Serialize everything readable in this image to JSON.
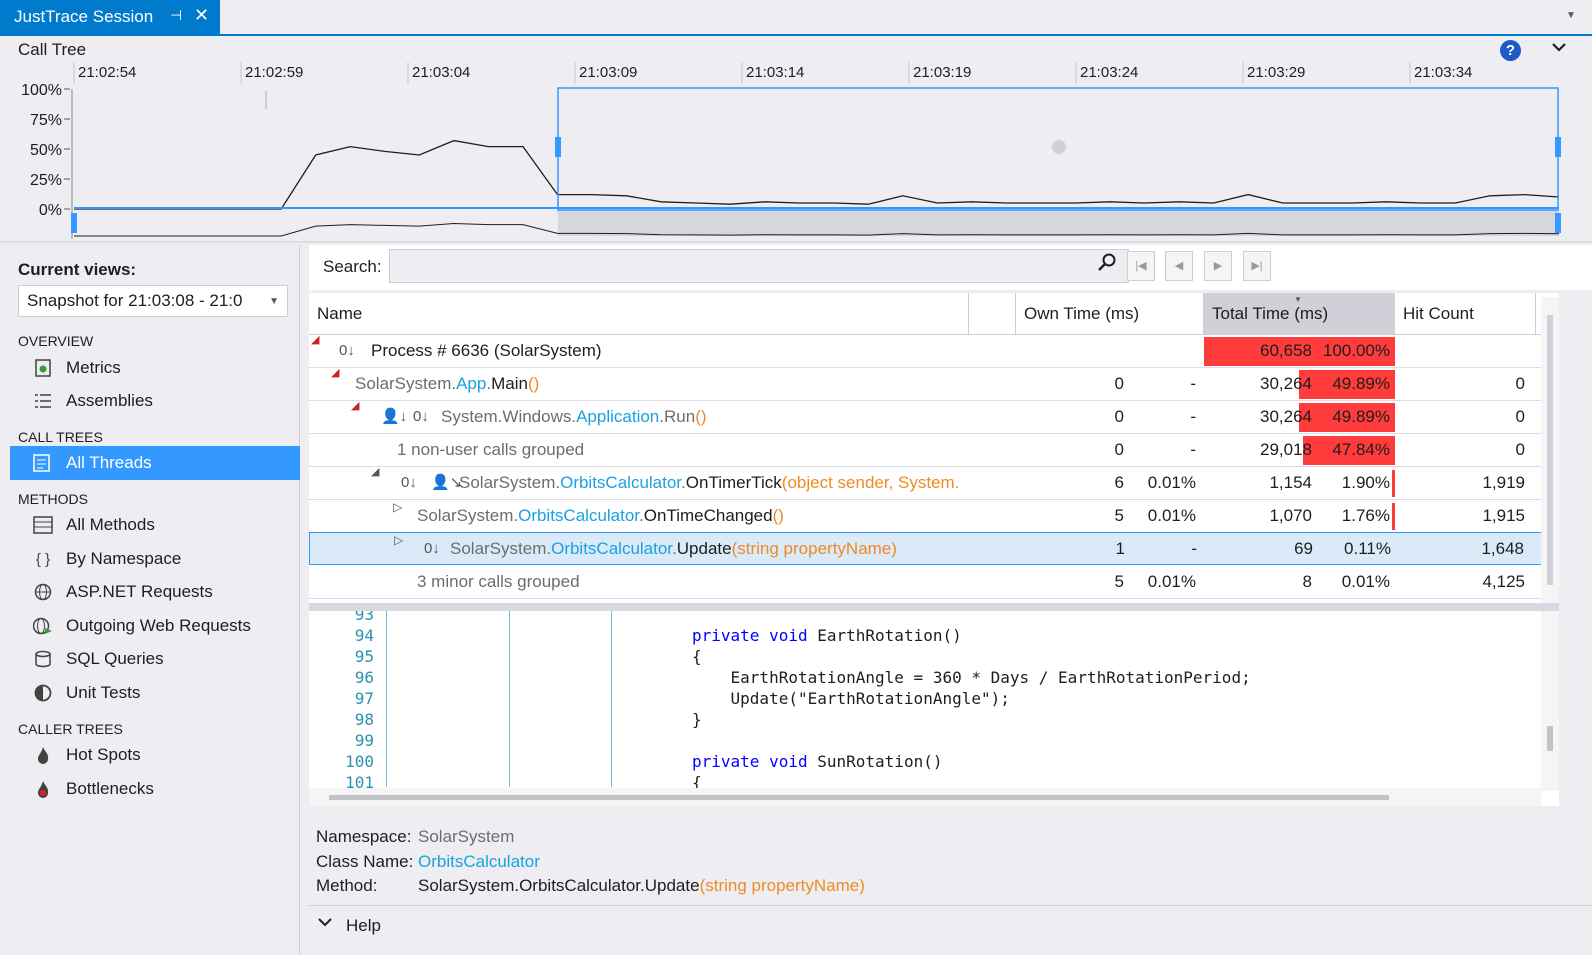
{
  "tab": {
    "title": "JustTrace Session",
    "pin": "⊣",
    "close": "✕"
  },
  "header": {
    "title": "Call Tree",
    "help": "?",
    "collapse": "⌄"
  },
  "timeline": {
    "ticks": [
      "21:02:54",
      "21:02:59",
      "21:03:04",
      "21:03:09",
      "21:03:14",
      "21:03:19",
      "21:03:24",
      "21:03:29",
      "21:03:34"
    ],
    "y_labels": [
      "100%",
      "75%",
      "50%",
      "25%",
      "0%"
    ]
  },
  "chart_data": {
    "type": "line",
    "title": "",
    "xlabel": "",
    "ylabel": "",
    "x": [
      "21:02:54",
      "21:02:55",
      "21:02:56",
      "21:02:57",
      "21:02:58",
      "21:02:59",
      "21:03:00",
      "21:03:01",
      "21:03:02",
      "21:03:03",
      "21:03:04",
      "21:03:05",
      "21:03:06",
      "21:03:07",
      "21:03:08",
      "21:03:09",
      "21:03:10",
      "21:03:11",
      "21:03:12",
      "21:03:13",
      "21:03:14",
      "21:03:15",
      "21:03:16",
      "21:03:17",
      "21:03:18",
      "21:03:19",
      "21:03:20",
      "21:03:21",
      "21:03:22",
      "21:03:23",
      "21:03:24",
      "21:03:25",
      "21:03:26",
      "21:03:27",
      "21:03:28",
      "21:03:29",
      "21:03:30",
      "21:03:31",
      "21:03:32",
      "21:03:33",
      "21:03:34",
      "21:03:35",
      "21:03:36",
      "21:03:37"
    ],
    "series": [
      {
        "values": [
          0,
          0,
          0,
          0,
          0,
          0,
          0,
          45,
          52,
          48,
          45,
          57,
          52,
          52,
          12,
          12,
          11,
          6,
          5,
          4,
          6,
          5,
          5,
          4,
          11,
          5,
          6,
          5,
          5,
          5,
          6,
          5,
          6,
          5,
          12,
          5,
          5,
          5,
          6,
          5,
          5,
          11,
          12,
          10
        ]
      }
    ],
    "ylim": [
      0,
      100
    ]
  },
  "leftpanel": {
    "current_views": "Current views:",
    "snapshot": "Snapshot for 21:03:08 - 21:0",
    "sections": {
      "overview": "OVERVIEW",
      "call_trees": "CALL TREES",
      "methods": "METHODS",
      "caller_trees": "CALLER TREES"
    },
    "items": {
      "metrics": "Metrics",
      "assemblies": "Assemblies",
      "all_threads": "All Threads",
      "all_methods": "All Methods",
      "by_namespace": "By Namespace",
      "aspnet": "ASP.NET Requests",
      "outgoing": "Outgoing Web Requests",
      "sql": "SQL Queries",
      "unit_tests": "Unit Tests",
      "hot_spots": "Hot Spots",
      "bottlenecks": "Bottlenecks"
    }
  },
  "search": {
    "label": "Search:",
    "value": ""
  },
  "grid": {
    "columns": {
      "name": "Name",
      "own": "Own Time (ms)",
      "total": "Total Time (ms)",
      "hits": "Hit Count"
    },
    "rows": [
      {
        "name_plain": "Process  # 6636 (SolarSystem)",
        "own": "",
        "own_pct": "",
        "total": "60,658",
        "total_pct": "100.00%",
        "hits": ""
      },
      {
        "ns": "SolarSystem.",
        "cls": "App",
        "dot": ".",
        "method": "Main",
        "args": "()",
        "own": "0",
        "own_pct": "-",
        "total": "30,264",
        "total_pct": "49.89%",
        "hits": "0"
      },
      {
        "ns": "System.Windows.",
        "cls": "Application",
        "dot": ".",
        "method": "Run",
        "args": "()",
        "own": "0",
        "own_pct": "-",
        "total": "30,264",
        "total_pct": "49.89%",
        "hits": "0"
      },
      {
        "name_plain": "1 non-user calls grouped",
        "own": "0",
        "own_pct": "-",
        "total": "29,018",
        "total_pct": "47.84%",
        "hits": "0"
      },
      {
        "ns": "SolarSystem.",
        "cls": "OrbitsCalculator",
        "dot": ".",
        "method": "OnTimerTick",
        "args": "(object sender, System.",
        "own": "6",
        "own_pct": "0.01%",
        "total": "1,154",
        "total_pct": "1.90%",
        "hits": "1,919"
      },
      {
        "ns": "SolarSystem.",
        "cls": "OrbitsCalculator",
        "dot": ".",
        "method": "OnTimeChanged",
        "args": "()",
        "own": "5",
        "own_pct": "0.01%",
        "total": "1,070",
        "total_pct": "1.76%",
        "hits": "1,915"
      },
      {
        "ns": "SolarSystem.",
        "cls": "OrbitsCalculator",
        "dot": ".",
        "method": "Update",
        "args": "(string propertyName)",
        "own": "1",
        "own_pct": "-",
        "total": "69",
        "total_pct": "0.11%",
        "hits": "1,648"
      },
      {
        "name_plain": "3 minor calls grouped",
        "own": "5",
        "own_pct": "0.01%",
        "total": "8",
        "total_pct": "0.01%",
        "hits": "4,125"
      }
    ]
  },
  "code": {
    "lines": [
      {
        "n": "93",
        "text": ""
      },
      {
        "n": "94",
        "text": "private void EarthRotation()"
      },
      {
        "n": "95",
        "text": "{"
      },
      {
        "n": "96",
        "text": "    EarthRotationAngle = 360 * Days / EarthRotationPeriod;"
      },
      {
        "n": "97",
        "text": "    Update(\"EarthRotationAngle\");"
      },
      {
        "n": "98",
        "text": "}"
      },
      {
        "n": "99",
        "text": ""
      },
      {
        "n": "100",
        "text": "private void SunRotation()"
      },
      {
        "n": "101",
        "text": "{"
      }
    ]
  },
  "details": {
    "namespace_label": "Namespace:",
    "namespace_value": "SolarSystem",
    "class_label": "Class Name:",
    "class_value": "OrbitsCalculator",
    "method_label": "Method:",
    "method_value": "SolarSystem.OrbitsCalculator.Update",
    "method_args": "(string propertyName)"
  },
  "help": {
    "label": "Help"
  },
  "colors": {
    "accent": "#007acc",
    "selection": "#3399ff",
    "bar": "#ff3b3b",
    "class": "#1ba1e2",
    "args": "#f08a24"
  }
}
